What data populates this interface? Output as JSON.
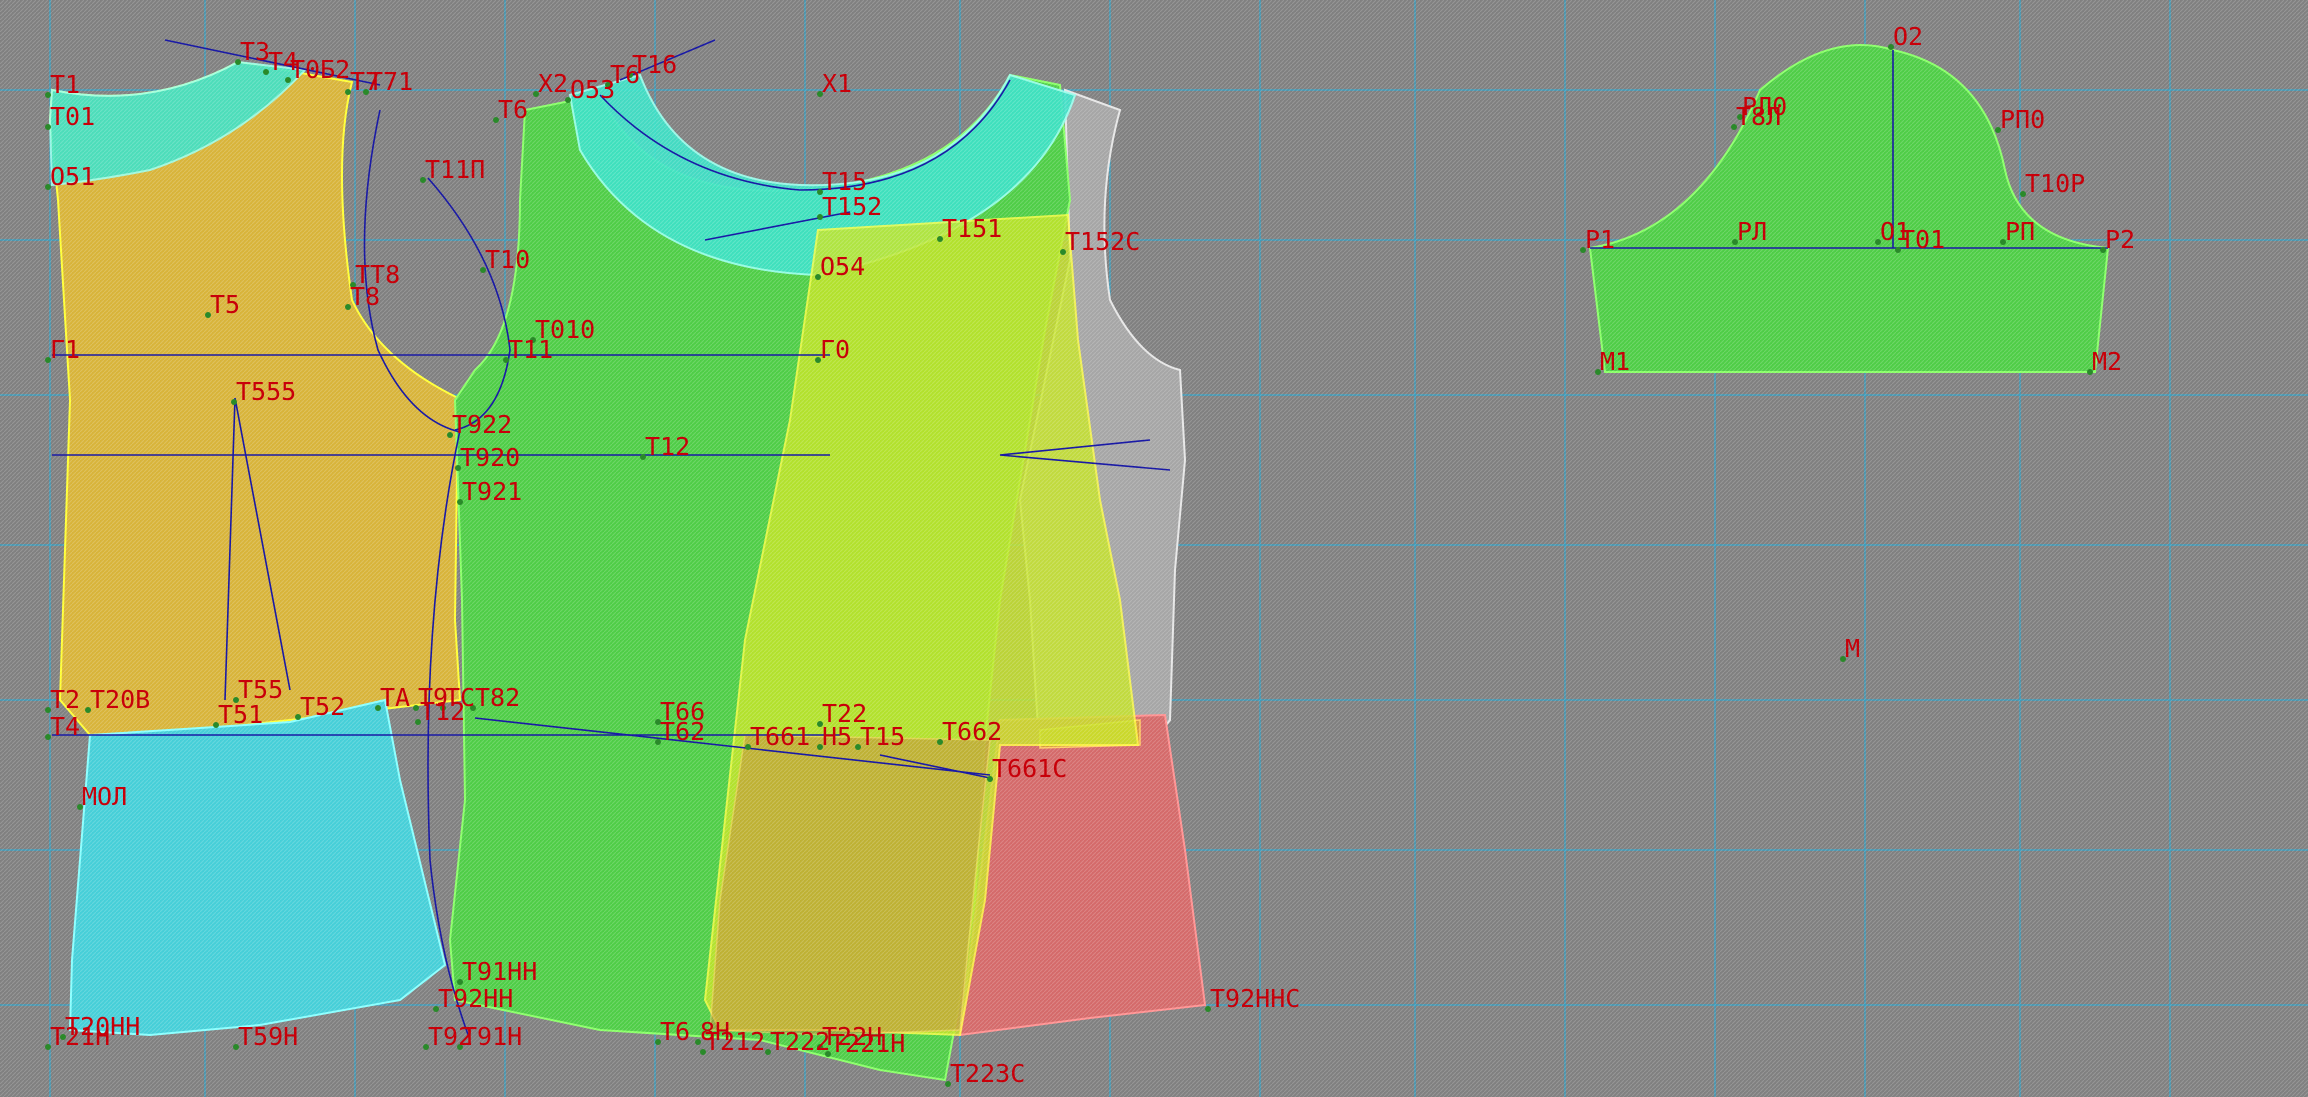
{
  "app": {
    "view": "pattern-drafting-canvas"
  },
  "colors": {
    "background": "#808080",
    "grid": "#2ea3c9",
    "label": "#c8000a",
    "construction_line": "#1a1aa6",
    "point": "#2a8a2a"
  },
  "pieces": [
    {
      "name": "back-bodice-upper",
      "fill": "#d8b43a",
      "stroke": "#ffff33"
    },
    {
      "name": "back-bodice-lower",
      "fill": "#46cfd8",
      "stroke": "#88ffff"
    },
    {
      "name": "front-bodice-main",
      "fill": "#4fcd47",
      "stroke": "#88ff66"
    },
    {
      "name": "front-neck-facing",
      "fill": "#3ee2c8",
      "stroke": "#99ffee"
    },
    {
      "name": "side-panel-yellow",
      "fill": "#c8e628",
      "stroke": "#ffff44"
    },
    {
      "name": "side-panel-grey",
      "fill": "#a6a6a6",
      "stroke": "#e6e6e6"
    },
    {
      "name": "side-panel-red",
      "fill": "#d46a6a",
      "stroke": "#ff9090"
    },
    {
      "name": "side-panel-orange",
      "fill": "#d69a3c",
      "stroke": "#ffcc66"
    },
    {
      "name": "sleeve",
      "fill": "#4fcd47",
      "stroke": "#88ff66"
    }
  ],
  "labels": [
    "Т1",
    "Т3",
    "Т4",
    "Т0Б2",
    "Т7",
    "Т71",
    "Т01",
    "О51",
    "ТТ8",
    "Т8",
    "Т5",
    "Г1",
    "Т555",
    "Т922",
    "Т920",
    "Т921",
    "Т2",
    "Т20В",
    "Т55",
    "Т51",
    "Т52",
    "ТА",
    "Т9",
    "ТС",
    "Т82",
    "Т12",
    "Т4",
    "Т11П",
    "Т10",
    "Т010",
    "Т6",
    "Т11",
    "Т12",
    "Т66",
    "Т62",
    "Т661",
    "Х2",
    "О53",
    "Т6",
    "Т16",
    "Х1",
    "Т15",
    "Т152",
    "Т151",
    "О54",
    "Г0",
    "Т152С",
    "Т22",
    "Н5",
    "Т15",
    "Т662",
    "Т661С",
    "МОЛ",
    "Т91НН",
    "Т92НН",
    "Т92",
    "Т91Н",
    "Т20НН",
    "Т21Н",
    "Т59Н",
    "Т6",
    "8Н",
    "Т212",
    "Т222",
    "Т22Н",
    "Т221Н",
    "Т223С",
    "Т92ННС",
    "О2",
    "РЛ0",
    "Т8Л",
    "РП0",
    "Т10Р",
    "Р1",
    "РЛ",
    "О1",
    "Т01",
    "РП",
    "Р2",
    "М1",
    "М2",
    "М"
  ]
}
